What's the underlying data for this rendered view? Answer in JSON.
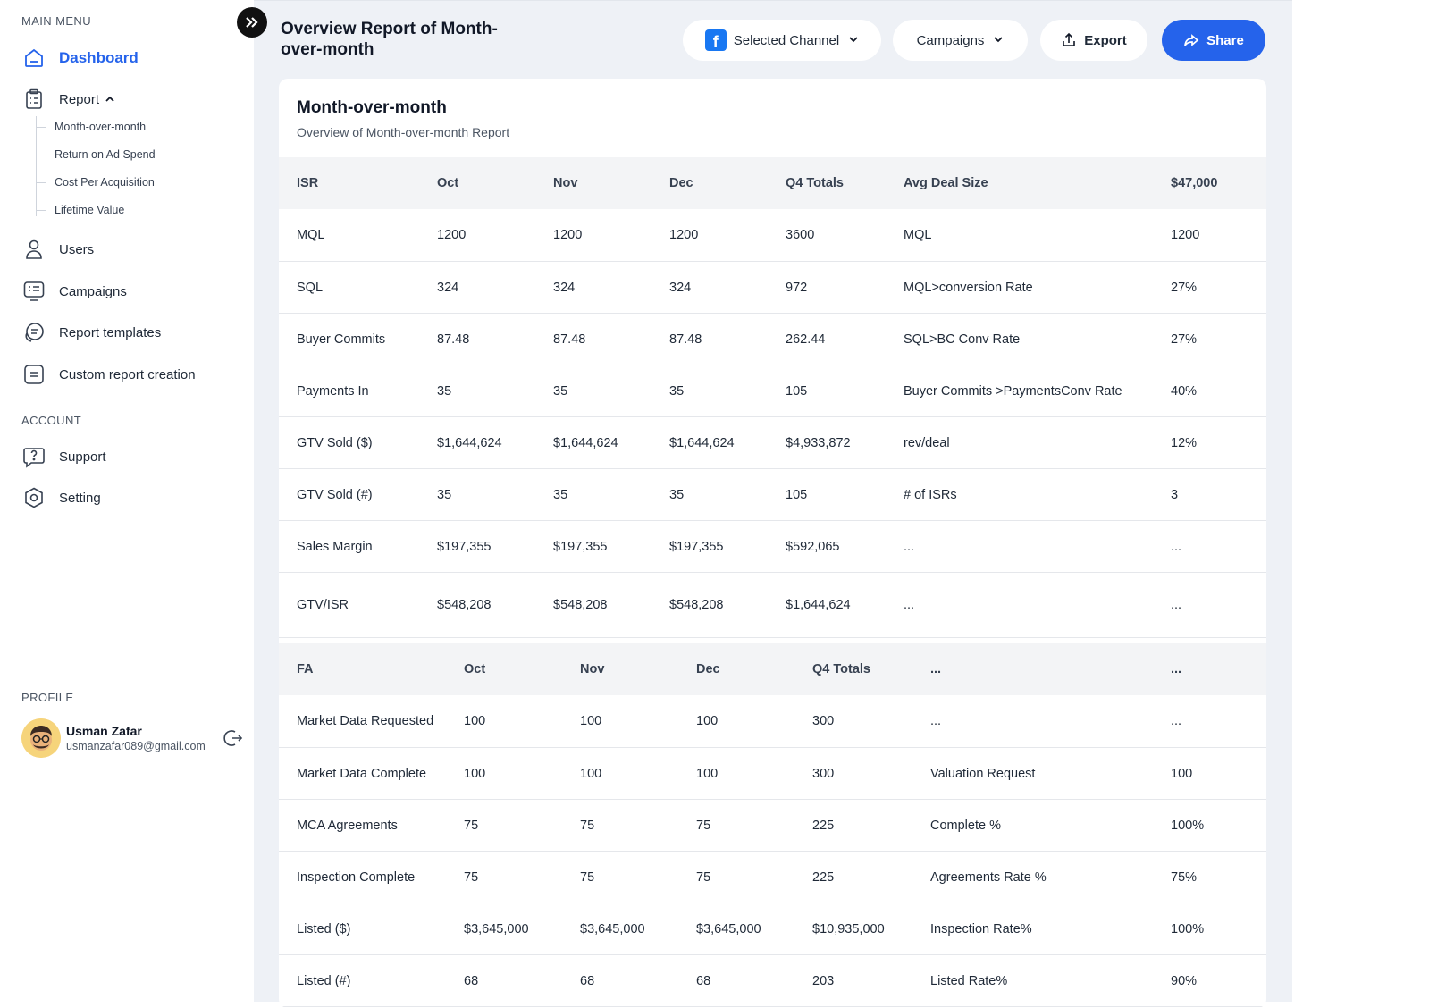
{
  "sidebar": {
    "main_menu_label": "MAIN MENU",
    "dashboard": "Dashboard",
    "report": "Report",
    "report_sub": [
      "Month-over-month",
      "Return on Ad Spend",
      "Cost Per Acquisition",
      "Lifetime Value"
    ],
    "users": "Users",
    "campaigns": "Campaigns",
    "report_templates": "Report templates",
    "custom_report": "Custom report creation",
    "account_label": "ACCOUNT",
    "support": "Support",
    "setting": "Setting",
    "profile_label": "PROFILE",
    "profile": {
      "name": "Usman Zafar",
      "email": "usmanzafar089@gmail.com"
    }
  },
  "header": {
    "title": "Overview Report of Month-over-month",
    "channel": "Selected Channel",
    "campaigns": "Campaigns",
    "export": "Export",
    "share": "Share"
  },
  "card": {
    "title": "Month-over-month",
    "subtitle": "Overview of Month-over-month Report"
  },
  "table1": {
    "headers": [
      "ISR",
      "Oct",
      "Nov",
      "Dec",
      "Q4 Totals",
      "Avg Deal Size",
      "$47,000"
    ],
    "rows": [
      [
        "MQL",
        "1200",
        "1200",
        "1200",
        "3600",
        "MQL",
        "1200"
      ],
      [
        "SQL",
        "324",
        "324",
        "324",
        "972",
        "MQL>conversion Rate",
        "27%"
      ],
      [
        "Buyer Commits",
        "87.48",
        "87.48",
        "87.48",
        "262.44",
        "SQL>BC Conv Rate",
        "27%"
      ],
      [
        "Payments In",
        "35",
        "35",
        "35",
        "105",
        "Buyer Commits >PaymentsConv Rate",
        "40%"
      ],
      [
        "GTV Sold ($)",
        "$1,644,624",
        "$1,644,624",
        "$1,644,624",
        "$4,933,872",
        "rev/deal",
        "12%"
      ],
      [
        "GTV Sold (#)",
        "35",
        "35",
        "35",
        "105",
        "# of ISRs",
        "3"
      ],
      [
        "Sales Margin",
        "$197,355",
        "$197,355",
        "$197,355",
        "$592,065",
        "...",
        "..."
      ],
      [
        "GTV/ISR",
        "$548,208",
        "$548,208",
        "$548,208",
        "$1,644,624",
        "...",
        "..."
      ]
    ]
  },
  "table2": {
    "headers": [
      "FA",
      "Oct",
      "Nov",
      "Dec",
      "Q4 Totals",
      "...",
      "..."
    ],
    "rows": [
      [
        "Market Data Requested",
        "100",
        "100",
        "100",
        "300",
        "...",
        "..."
      ],
      [
        "Market Data Complete",
        "100",
        "100",
        "100",
        "300",
        "Valuation Request",
        "100"
      ],
      [
        "MCA Agreements",
        "75",
        "75",
        "75",
        "225",
        "Complete %",
        "100%"
      ],
      [
        "Inspection Complete",
        "75",
        "75",
        "75",
        "225",
        "Agreements Rate %",
        "75%"
      ],
      [
        "Listed ($)",
        "$3,645,000",
        "$3,645,000",
        "$3,645,000",
        "$10,935,000",
        "Inspection Rate%",
        "100%"
      ],
      [
        "Listed (#)",
        "68",
        "68",
        "68",
        "203",
        "Listed Rate%",
        "90%"
      ]
    ]
  },
  "colors": {
    "accent": "#2563eb",
    "background": "#eef1f6",
    "facebook": "#1877f2"
  }
}
